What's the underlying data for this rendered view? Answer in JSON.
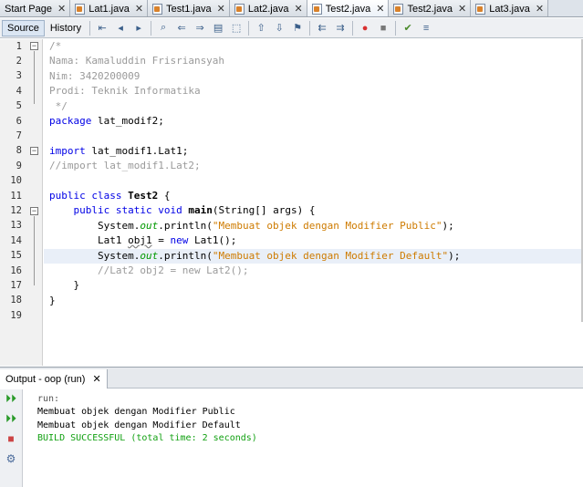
{
  "tabs": [
    {
      "label": "Start Page",
      "close": "✕",
      "icon": "none"
    },
    {
      "label": "Lat1.java",
      "close": "✕",
      "icon": "java-file-icon"
    },
    {
      "label": "Test1.java",
      "close": "✕",
      "icon": "java-file-icon"
    },
    {
      "label": "Lat2.java",
      "close": "✕",
      "icon": "java-file-icon"
    },
    {
      "label": "Test2.java",
      "close": "✕",
      "icon": "java-file-icon",
      "active": true
    },
    {
      "label": "Test2.java",
      "close": "✕",
      "icon": "java-file-icon"
    },
    {
      "label": "Lat3.java",
      "close": "✕",
      "icon": "java-file-icon"
    }
  ],
  "toolbar": {
    "source_label": "Source",
    "history_label": "History"
  },
  "editor": {
    "line_numbers": [
      "1",
      "2",
      "3",
      "4",
      "5",
      "6",
      "7",
      "8",
      "9",
      "10",
      "11",
      "12",
      "13",
      "14",
      "15",
      "16",
      "17",
      "18",
      "19"
    ],
    "highlighted_line": 15,
    "lines": [
      "/*",
      "Nama: Kamaluddin Frisriansyah",
      "Nim: 3420200009",
      "Prodi: Teknik Informatika",
      " */",
      "package lat_modif2;",
      "",
      "import lat_modif1.Lat1;",
      "//import lat_modif1.Lat2;",
      "",
      "public class Test2 {",
      "    public static void main(String[] args) {",
      "        System.out.println(\"Membuat objek dengan Modifier Public\");",
      "        Lat1 obj1 = new Lat1();",
      "        System.out.println(\"Membuat objek dengan Modifier Default\");",
      "        //Lat2 obj2 = new Lat2();",
      "    }",
      "}",
      ""
    ]
  },
  "output": {
    "tab_label": "Output - oop (run)",
    "tab_close": "✕",
    "lines": [
      "run:",
      "Membuat objek dengan Modifier Public",
      "Membuat objek dengan Modifier Default",
      "BUILD SUCCESSFUL (total time: 2 seconds)"
    ]
  }
}
